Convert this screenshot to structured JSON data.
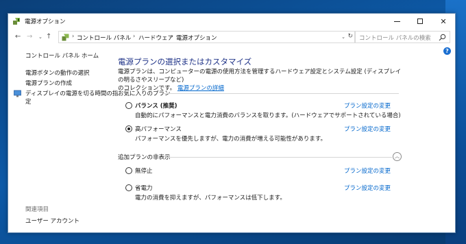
{
  "window": {
    "title": "電源オプション",
    "minimize_glyph": "",
    "close_glyph": "✕"
  },
  "address": {
    "segments": [
      "コントロール パネル",
      "ハードウェア",
      "電源オプション"
    ],
    "search_placeholder": "コントロール パネルの検索"
  },
  "help": {
    "label": "?"
  },
  "sidebar": {
    "home": "コントロール パネル ホーム",
    "items": [
      "電源ボタンの動作の選択",
      "電源プランの作成",
      "ディスプレイの電源を切る時間の指",
      "定"
    ],
    "related_header": "関連項目",
    "related_items": [
      "ユーザー アカウント"
    ]
  },
  "main": {
    "heading": "電源プランの選択またはカスタマイズ",
    "description_line1": "電源プランは、コンピューターの電源の使用方法を管理するハードウェア設定とシステム設定 (ディスプレイの明るさやスリープなど)",
    "description_line2": "のコレクションです。",
    "description_link": "電源プランの詳細",
    "favorites_header": "お気に入りのプラン",
    "hidden_header": "追加プランの非表示",
    "plan_link_label": "プラン設定の変更",
    "plans": [
      {
        "name": "バランス (推奨)",
        "desc": "自動的にパフォーマンスと電力消費のバランスを取ります。(ハードウェアでサポートされている場合)",
        "selected": false
      },
      {
        "name": "高パフォーマンス",
        "desc": "パフォーマンスを優先しますが、電力の消費が増える可能性があります。",
        "selected": true
      },
      {
        "name": "無停止",
        "desc": "",
        "selected": false
      },
      {
        "name": "省電力",
        "desc": "電力の消費を抑えますが、パフォーマンスは低下します。",
        "selected": false
      }
    ]
  }
}
